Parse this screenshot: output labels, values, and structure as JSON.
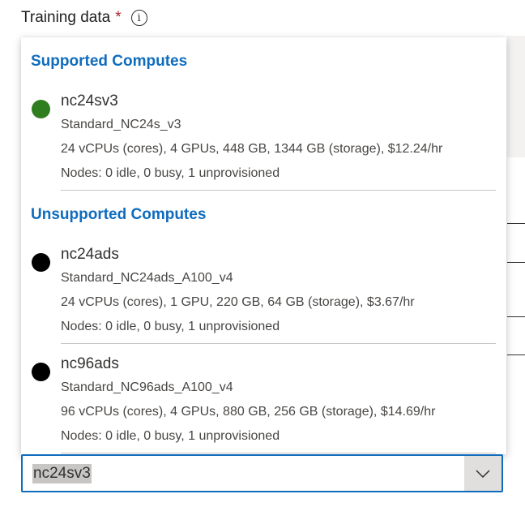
{
  "field": {
    "label": "Training data",
    "required_marker": "*",
    "info_icon": "info-circle-icon"
  },
  "dropdown": {
    "selected_value": "nc24sv3",
    "chevron_icon": "chevron-down-icon",
    "accent_color": "#0f6cbd",
    "groups": [
      {
        "header": "Supported Computes",
        "options": [
          {
            "name": "nc24sv3",
            "sku": "Standard_NC24s_v3",
            "specs": "24 vCPUs (cores), 4 GPUs, 448 GB, 1344 GB (storage), $12.24/hr",
            "nodes": "Nodes: 0 idle, 0 busy, 1 unprovisioned",
            "status_color": "#2e7d1f"
          }
        ]
      },
      {
        "header": "Unsupported Computes",
        "options": [
          {
            "name": "nc24ads",
            "sku": "Standard_NC24ads_A100_v4",
            "specs": "24 vCPUs (cores), 1 GPU, 220 GB, 64 GB (storage), $3.67/hr",
            "nodes": "Nodes: 0 idle, 0 busy, 1 unprovisioned",
            "status_color": "#000000"
          },
          {
            "name": "nc96ads",
            "sku": "Standard_NC96ads_A100_v4",
            "specs": "96 vCPUs (cores), 4 GPUs, 880 GB, 256 GB (storage), $14.69/hr",
            "nodes": "Nodes: 0 idle, 0 busy, 1 unprovisioned",
            "status_color": "#000000"
          }
        ]
      }
    ]
  }
}
